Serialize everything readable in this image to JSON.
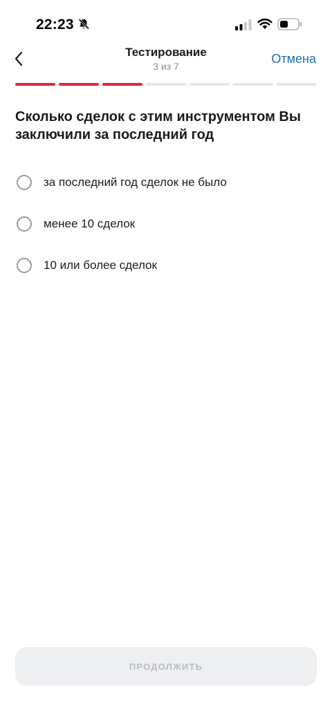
{
  "status_bar": {
    "time": "22:23",
    "icons": [
      "bell-slash-icon",
      "signal-icon",
      "wifi-icon",
      "battery-icon"
    ]
  },
  "header": {
    "back_icon": "chevron-left-icon",
    "title": "Тестирование",
    "subtitle": "3 из 7",
    "cancel_label": "Отмена"
  },
  "progress": {
    "current": 3,
    "total": 7
  },
  "question": {
    "text": "Сколько сделок с этим инструментом Вы заключили за последний год",
    "options": [
      {
        "label": "за последний год сделок не было",
        "selected": false
      },
      {
        "label": "менее 10 сделок",
        "selected": false
      },
      {
        "label": "10 или более сделок",
        "selected": false
      }
    ]
  },
  "footer": {
    "continue_label": "ПРОДОЛЖИТЬ",
    "continue_enabled": false
  },
  "colors": {
    "accent": "#e5243b",
    "link": "#1a6fb0",
    "progress_inactive": "#e4e6e8",
    "button_disabled_bg": "#eeeff1",
    "button_disabled_text": "#b8babd"
  }
}
